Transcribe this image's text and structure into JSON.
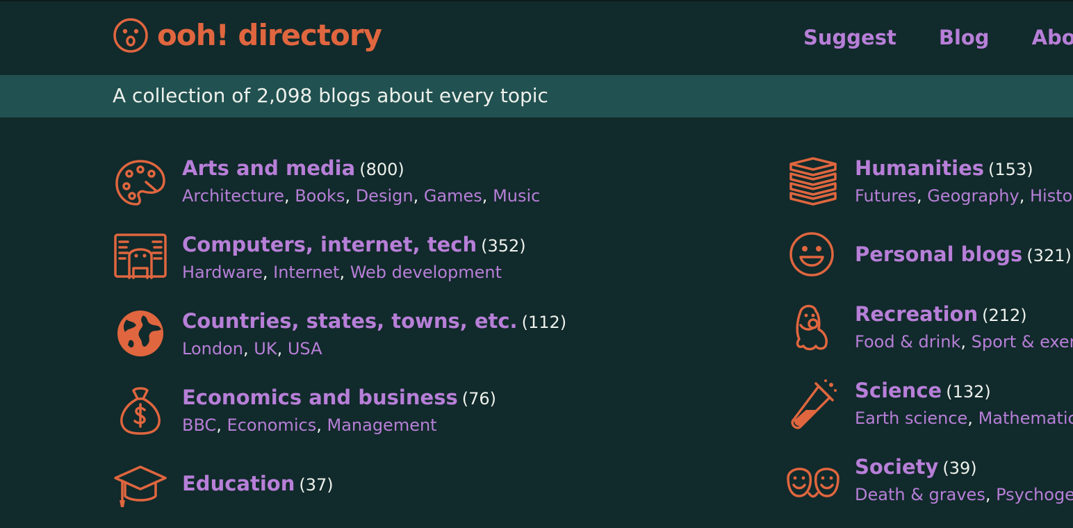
{
  "site": {
    "brand_main": "ooh",
    "brand_bang": "!",
    "brand_rest": " directory",
    "tagline": "A collection of 2,098 blogs about every topic"
  },
  "nav": {
    "suggest": "Suggest",
    "blog": "Blog",
    "about": "About"
  },
  "left_categories": [
    {
      "title": "Arts and media",
      "count": "(800)",
      "subs": [
        "Architecture",
        "Books",
        "Design",
        "Games",
        "Music"
      ],
      "icon": "palette-icon"
    },
    {
      "title": "Computers, internet, tech",
      "count": "(352)",
      "subs": [
        "Hardware",
        "Internet",
        "Web development"
      ],
      "icon": "computer-screen-icon"
    },
    {
      "title": "Countries, states, towns, etc.",
      "count": "(112)",
      "subs": [
        "London",
        "UK",
        "USA"
      ],
      "icon": "globe-icon"
    },
    {
      "title": "Economics and business",
      "count": "(76)",
      "subs": [
        "BBC",
        "Economics",
        "Management"
      ],
      "icon": "money-bag-icon"
    },
    {
      "title": "Education",
      "count": "(37)",
      "subs": [],
      "icon": "graduation-cap-icon"
    }
  ],
  "right_categories": [
    {
      "title": "Humanities",
      "count": "(153)",
      "subs": [
        "Futures",
        "Geography",
        "History"
      ],
      "icon": "books-stack-icon"
    },
    {
      "title": "Personal blogs",
      "count": "(321)",
      "subs": [],
      "icon": "smiley-face-icon"
    },
    {
      "title": "Recreation",
      "count": "(212)",
      "subs": [
        "Food & drink",
        "Sport & exercise"
      ],
      "icon": "ghost-icon"
    },
    {
      "title": "Science",
      "count": "(132)",
      "subs": [
        "Earth science",
        "Mathematics"
      ],
      "icon": "test-tube-icon"
    },
    {
      "title": "Society",
      "count": "(39)",
      "subs": [
        "Death & graves",
        "Psychogeography"
      ],
      "icon": "two-faces-icon"
    }
  ],
  "colors": {
    "background": "#112a2b",
    "band": "#215150",
    "accent_orange": "#e0663f",
    "link_purple": "#b77fd8",
    "text": "#eef1ec"
  }
}
